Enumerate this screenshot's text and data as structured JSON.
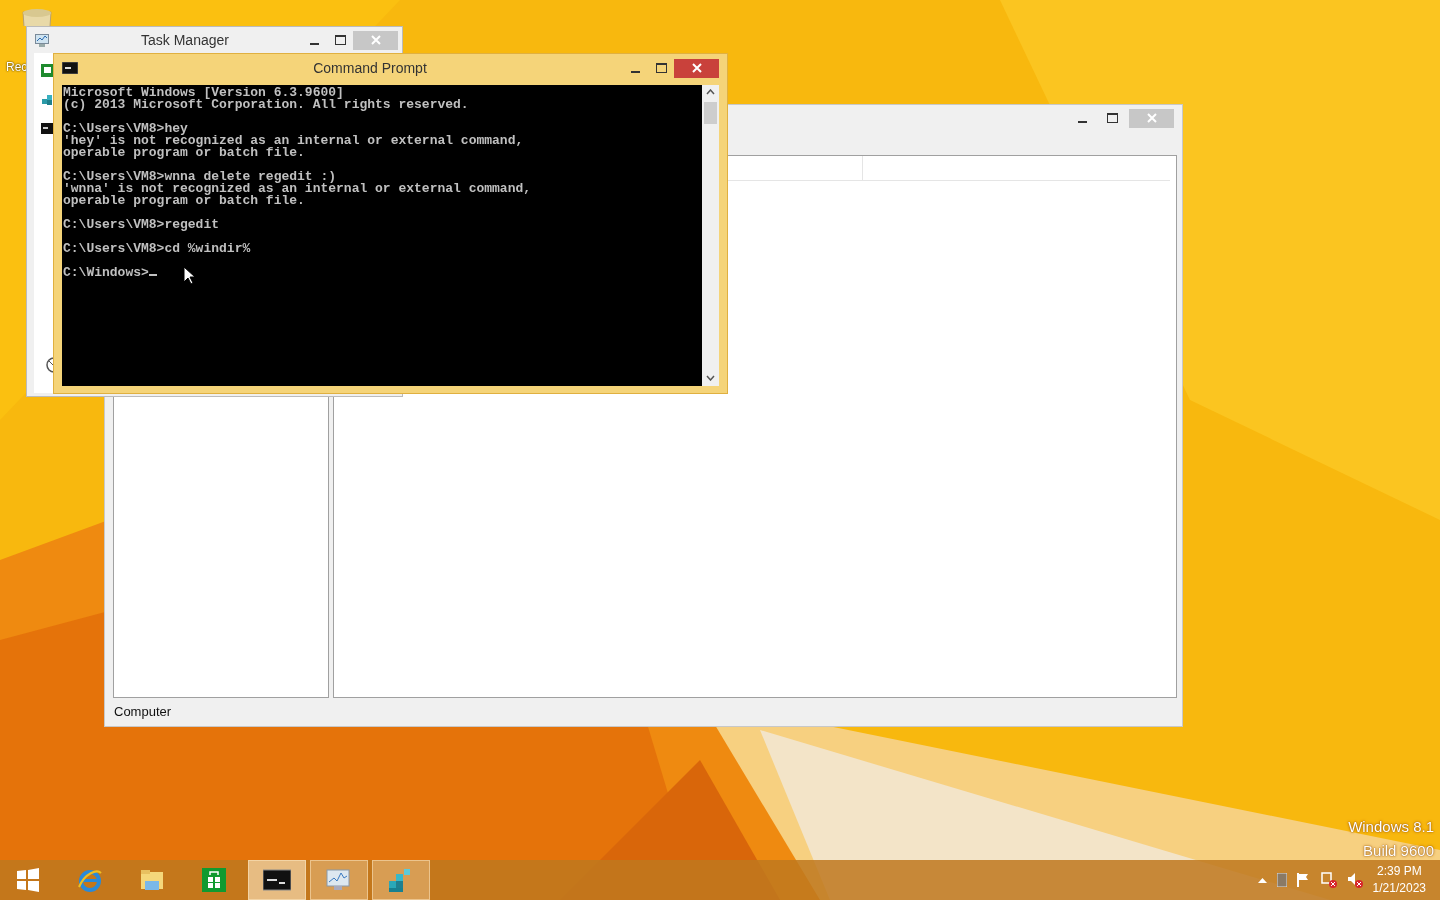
{
  "desktop": {
    "icons": [
      {
        "label": "Rec"
      }
    ]
  },
  "registry_editor": {
    "status_bar": "Computer"
  },
  "task_manager": {
    "title": "Task Manager"
  },
  "command_prompt": {
    "title": "Command Prompt",
    "blocks": [
      [
        "Microsoft Windows [Version 6.3.9600]",
        "(c) 2013 Microsoft Corporation. All rights reserved."
      ],
      [
        "C:\\Users\\VM8>hey",
        "'hey' is not recognized as an internal or external command,",
        "operable program or batch file."
      ],
      [
        "C:\\Users\\VM8>wnna delete regedit :)",
        "'wnna' is not recognized as an internal or external command,",
        "operable program or batch file."
      ],
      [
        "C:\\Users\\VM8>regedit"
      ],
      [
        "C:\\Users\\VM8>cd %windir%"
      ],
      [
        "C:\\Windows>"
      ]
    ]
  },
  "version_text": [
    "Windows 8.1",
    "Build 9600"
  ],
  "taskbar": {
    "buttons": [
      {
        "kind": "start",
        "running": false,
        "selected": false
      },
      {
        "kind": "browser",
        "running": false,
        "selected": false
      },
      {
        "kind": "folder",
        "running": false,
        "selected": false
      },
      {
        "kind": "store",
        "running": false,
        "selected": false
      },
      {
        "kind": "console",
        "running": true,
        "selected": true
      },
      {
        "kind": "monitor",
        "running": true,
        "selected": false
      },
      {
        "kind": "registry",
        "running": true,
        "selected": false
      }
    ]
  },
  "tray": {
    "time": "2:39 PM",
    "date": "1/21/2023"
  }
}
